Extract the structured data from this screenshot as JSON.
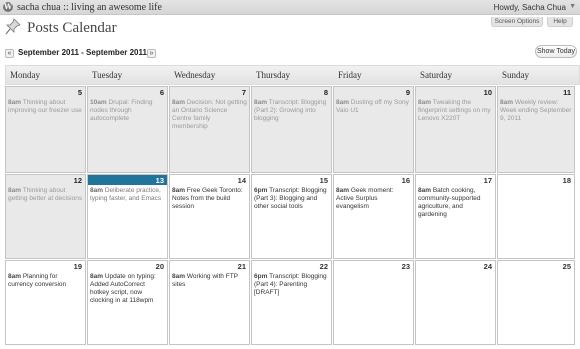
{
  "adminbar": {
    "site_name": "sacha chua :: living an awesome life",
    "howdy": "Howdy, Sacha Chua",
    "logo_icon": "wordpress-logo-icon",
    "caret_icon": "chevron-down-icon"
  },
  "tabs": {
    "screen_options": "Screen Options",
    "help": "Help"
  },
  "page": {
    "title": "Posts Calendar",
    "title_icon": "pin-icon"
  },
  "nav": {
    "prev": "«",
    "next": "»",
    "range": "September 2011 - September 2011",
    "show_today": "Show Today"
  },
  "days": [
    "Monday",
    "Tuesday",
    "Wednesday",
    "Thursday",
    "Friday",
    "Saturday",
    "Sunday"
  ],
  "colors": {
    "today_bar": "#21759b",
    "past_bg": "#e9e9e9"
  },
  "weeks": [
    [
      {
        "num": "5",
        "state": "past",
        "items": [
          {
            "time": "8am",
            "title": "Thinking about improving our freezer use"
          }
        ]
      },
      {
        "num": "6",
        "state": "past",
        "items": [
          {
            "time": "10am",
            "title": "Drupal: Finding nodes through autocomplete"
          }
        ]
      },
      {
        "num": "7",
        "state": "past",
        "items": [
          {
            "time": "8am",
            "title": "Decision: Not getting an Ontario Science Centre family membership"
          }
        ]
      },
      {
        "num": "8",
        "state": "past",
        "items": [
          {
            "time": "8am",
            "title": "Transcript: Blogging (Part 2): Growing into blogging"
          }
        ]
      },
      {
        "num": "9",
        "state": "past",
        "items": [
          {
            "time": "8am",
            "title": "Dusting off my Sony Vaio U1"
          }
        ]
      },
      {
        "num": "10",
        "state": "past",
        "items": [
          {
            "time": "8am",
            "title": "Tweaking the fingerprint settings on my Lenovo X220T"
          }
        ]
      },
      {
        "num": "11",
        "state": "past",
        "items": [
          {
            "time": "8am",
            "title": "Weekly review: Week ending September 9, 2011"
          }
        ]
      }
    ],
    [
      {
        "num": "12",
        "state": "past",
        "items": [
          {
            "time": "8am",
            "title": "Thinking about getting better at decisions"
          }
        ]
      },
      {
        "num": "13",
        "state": "today",
        "items": [
          {
            "time": "8am",
            "title": "Deliberate practice, typing faster, and Emacs"
          }
        ]
      },
      {
        "num": "14",
        "state": "future",
        "items": [
          {
            "time": "8am",
            "title": "Free Geek Toronto: Notes from the build session"
          }
        ]
      },
      {
        "num": "15",
        "state": "future",
        "items": [
          {
            "time": "6pm",
            "title": "Transcript: Blogging (Part 3): Blogging and other social tools"
          }
        ]
      },
      {
        "num": "16",
        "state": "future",
        "items": [
          {
            "time": "8am",
            "title": "Geek moment: Active Surplus evangelism"
          }
        ]
      },
      {
        "num": "17",
        "state": "future",
        "items": [
          {
            "time": "8am",
            "title": "Batch cooking, community-supported agriculture, and gardening"
          }
        ]
      },
      {
        "num": "18",
        "state": "future",
        "items": []
      }
    ],
    [
      {
        "num": "19",
        "state": "future",
        "items": [
          {
            "time": "8am",
            "title": "Planning for currency conversion"
          }
        ]
      },
      {
        "num": "20",
        "state": "future",
        "items": [
          {
            "time": "8am",
            "title": "Update on typing: Added AutoCorrect hotkey script, now clocking in at 118wpm"
          }
        ]
      },
      {
        "num": "21",
        "state": "future",
        "items": [
          {
            "time": "8am",
            "title": "Working with FTP sites"
          }
        ]
      },
      {
        "num": "22",
        "state": "future",
        "items": [
          {
            "time": "6pm",
            "title": "Transcript: Blogging (Part 4): Parenting [DRAFT]"
          }
        ]
      },
      {
        "num": "23",
        "state": "future",
        "items": []
      },
      {
        "num": "24",
        "state": "future",
        "items": []
      },
      {
        "num": "25",
        "state": "future",
        "items": []
      }
    ]
  ]
}
